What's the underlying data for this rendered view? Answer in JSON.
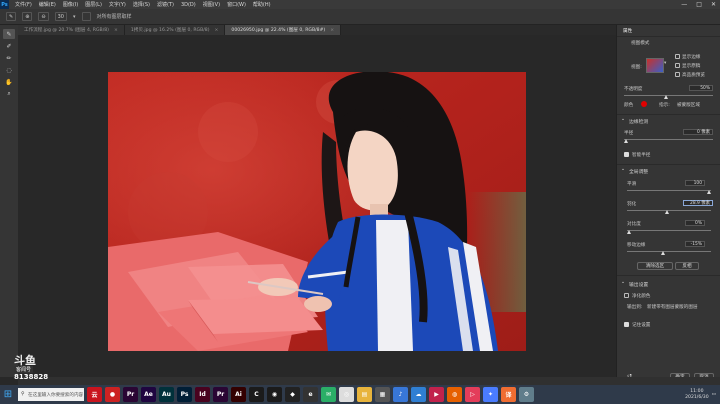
{
  "menubar": {
    "logo": "Ps",
    "items": [
      "文件(F)",
      "编辑(E)",
      "图像(I)",
      "图层(L)",
      "文字(Y)",
      "选择(S)",
      "滤镜(T)",
      "3D(D)",
      "视图(V)",
      "窗口(W)",
      "帮助(H)"
    ],
    "controls": [
      "—",
      "□",
      "✕"
    ]
  },
  "options": {
    "size_value": "30",
    "sample_all": "对所有图层取样"
  },
  "tabs": [
    {
      "label": "工作流程.jpg @ 20.7% (图层 4, RGB/8)",
      "active": false
    },
    {
      "label": "1拷贝.jpg @ 16.2% (图层 0, RGB/8)",
      "active": false
    },
    {
      "label": "00026950.jpg @ 22.4% (图层 0, RGB/8#)",
      "active": true
    }
  ],
  "panel": {
    "tab": "属性",
    "view_mode_title": "视图模式",
    "view_label": "视图:",
    "show_edges": "显示边缘",
    "show_original": "显示原稿",
    "high_quality": "高品质预览",
    "opacity_label": "不透明度",
    "opacity_value": "50%",
    "color_label": "颜色",
    "indicates_label": "指示:",
    "indicates_value": "被蒙版区域",
    "edge_detection": "边缘检测",
    "radius_label": "半径",
    "radius_value": "0 像素",
    "smart_radius": "智能半径",
    "global_refinement": "全局调整",
    "smooth_label": "平滑",
    "smooth_value": "100",
    "feather_label": "羽化",
    "feather_value": "28.9 像素",
    "contrast_label": "对比度",
    "contrast_value": "0%",
    "shift_edge_label": "移动边缘",
    "shift_edge_value": "-15%",
    "clear_selection": "清除选区",
    "invert": "反相",
    "output_settings": "输出设置",
    "decontaminate": "净化颜色",
    "output_to_label": "输出到:",
    "output_to_value": "新建带有图层蒙版的图层",
    "remember_settings": "记住设置",
    "ok": "确定",
    "cancel": "取消",
    "accent_color": "#e00000"
  },
  "taskbar": {
    "search_placeholder": "在这里输入你要搜索的内容",
    "apps": [
      {
        "name": "网易云",
        "color": "#c9141e",
        "glyph": "云"
      },
      {
        "name": "录屏",
        "color": "#c22",
        "glyph": "●"
      },
      {
        "name": "Premiere",
        "color": "#2a0634",
        "glyph": "Pr"
      },
      {
        "name": "After Effects",
        "color": "#1f0540",
        "glyph": "Ae"
      },
      {
        "name": "Audition",
        "color": "#00313b",
        "glyph": "Au"
      },
      {
        "name": "Photoshop",
        "color": "#001e36",
        "glyph": "Ps"
      },
      {
        "name": "InDesign",
        "color": "#49021f",
        "glyph": "Id"
      },
      {
        "name": "Premiere Rush",
        "color": "#2a0634",
        "glyph": "Pr"
      },
      {
        "name": "Illustrator",
        "color": "#330000",
        "glyph": "Ai"
      },
      {
        "name": "C4D",
        "color": "#1b1b1b",
        "glyph": "C"
      },
      {
        "name": "Blender",
        "color": "#1b1b1b",
        "glyph": "◉"
      },
      {
        "name": "达芬奇",
        "color": "#222",
        "glyph": "◆"
      },
      {
        "name": "浏览器",
        "color": "#333",
        "glyph": "e"
      },
      {
        "name": "微信",
        "color": "#2aae67",
        "glyph": "✉"
      },
      {
        "name": "Chrome",
        "color": "#ddd",
        "glyph": "◎"
      },
      {
        "name": "文件夹",
        "color": "#e8b43c",
        "glyph": "▤"
      },
      {
        "name": "应用",
        "color": "#555",
        "glyph": "▦"
      },
      {
        "name": "音乐",
        "color": "#3877d8",
        "glyph": "♪"
      },
      {
        "name": "网盘",
        "color": "#2f7fd3",
        "glyph": "☁"
      },
      {
        "name": "播放器",
        "color": "#c2224c",
        "glyph": "▶"
      },
      {
        "name": "火狐",
        "color": "#e66000",
        "glyph": "◍"
      },
      {
        "name": "视频",
        "color": "#e43d5a",
        "glyph": "▷"
      },
      {
        "name": "工具",
        "color": "#4a7cff",
        "glyph": "✦"
      },
      {
        "name": "翻译",
        "color": "#f06d32",
        "glyph": "译"
      },
      {
        "name": "设置",
        "color": "#607d8b",
        "glyph": "⚙"
      }
    ],
    "time": "11:00",
    "date": "2021/6/30"
  },
  "watermark": {
    "brand": "斗鱼",
    "sub": "客闻号",
    "id": "8138828"
  }
}
